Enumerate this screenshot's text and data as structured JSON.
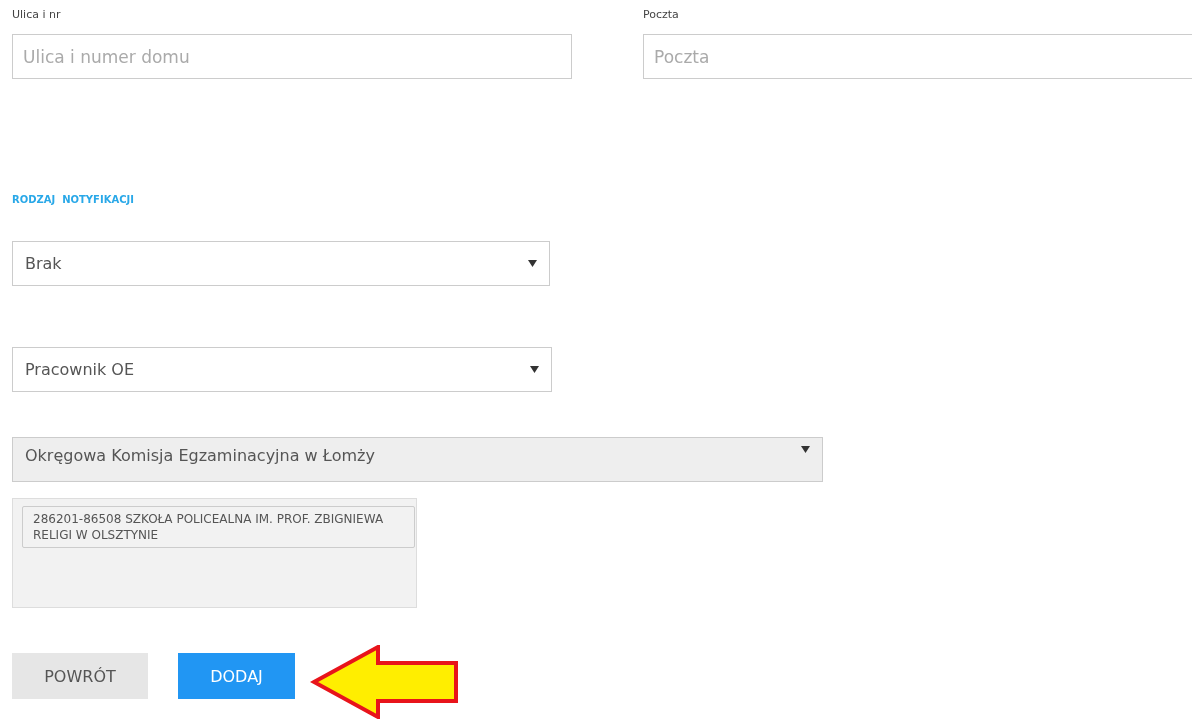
{
  "address_fields": [
    {
      "label": "Ulica i nr",
      "placeholder": "Ulica i numer domu"
    },
    {
      "label": "Poczta",
      "placeholder": "Poczta"
    }
  ],
  "section_heading": "RODZAJ  NOTYFIKACJI",
  "selects": [
    {
      "value": "Brak",
      "disabled": false
    },
    {
      "value": "Pracownik OE",
      "disabled": false
    },
    {
      "value": "Okręgowa Komisja Egzaminacyjna w Łomży",
      "disabled": true
    }
  ],
  "selected_items": [
    "286201-86508 SZKOŁA POLICEALNA IM. PROF. ZBIGNIEWA RELIGI W OLSZTYNIE"
  ],
  "buttons": [
    {
      "label": "POWRÓT",
      "kind": "secondary"
    },
    {
      "label": "DODAJ",
      "kind": "primary"
    }
  ]
}
